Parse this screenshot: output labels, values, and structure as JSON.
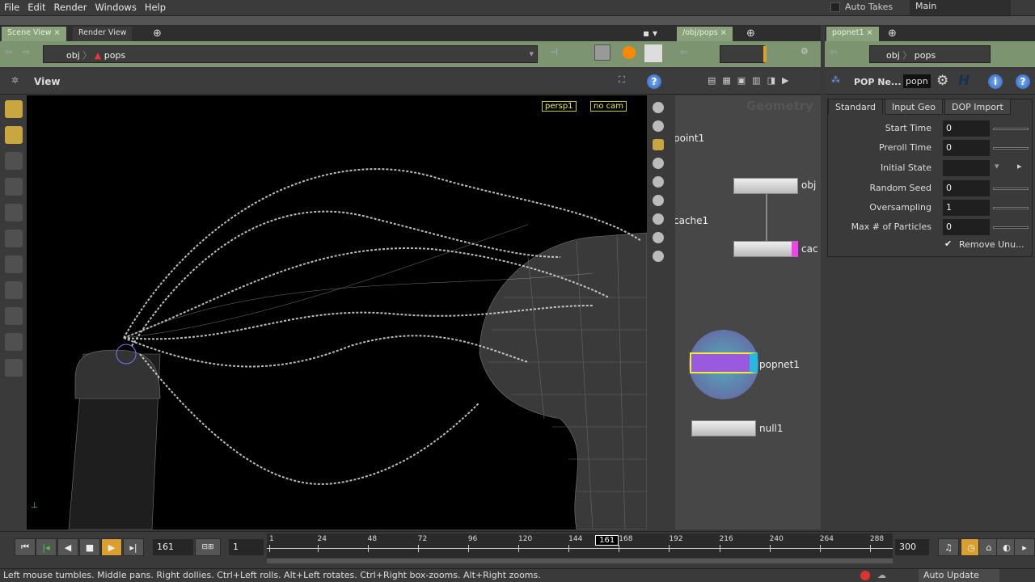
{
  "menu": [
    "File",
    "Edit",
    "Render",
    "Windows",
    "Help"
  ],
  "top_right": {
    "auto_takes": "Auto Takes",
    "take": "Main"
  },
  "scene_pane": {
    "tabs": [
      "Scene View",
      "Render View"
    ],
    "path": [
      "obj",
      "pops"
    ],
    "header": "View",
    "cam_menu": "persp1",
    "cam_select": "no cam"
  },
  "network_pane": {
    "tab": "/obj/pops",
    "context_label": "Geometry",
    "nodes": [
      {
        "name": "point1"
      },
      {
        "name": "obj"
      },
      {
        "name": "cache1"
      },
      {
        "name": "cac"
      },
      {
        "name": "popnet1"
      },
      {
        "name": "null1"
      }
    ]
  },
  "params_pane": {
    "tab": "popnet1",
    "path": [
      "obj",
      "pops"
    ],
    "op_type": "POP Ne...",
    "op_name": "popn",
    "tabs": [
      "Standard",
      "Input Geo",
      "DOP Import"
    ],
    "params": [
      {
        "label": "Start Time",
        "value": "0"
      },
      {
        "label": "Preroll Time",
        "value": "0"
      },
      {
        "label": "Initial State",
        "value": ""
      },
      {
        "label": "Random Seed",
        "value": "0"
      },
      {
        "label": "Oversampling",
        "value": "1"
      },
      {
        "label": "Max # of Particles",
        "value": "0"
      }
    ],
    "checkbox": {
      "label": "Remove Unu...",
      "checked": true
    }
  },
  "timeline": {
    "current_frame": "161",
    "step": "1",
    "end_frame": "300",
    "ticks": [
      "1",
      "24",
      "48",
      "72",
      "96",
      "120",
      "144",
      "168",
      "192",
      "216",
      "240",
      "264",
      "288"
    ],
    "marker": "161",
    "range": [
      1,
      300
    ]
  },
  "status": {
    "message": "Left mouse tumbles. Middle pans. Right dollies. Ctrl+Left rolls. Alt+Left rotates. Ctrl+Right box-zooms. Alt+Right zooms.",
    "auto_update": "Auto Update"
  }
}
